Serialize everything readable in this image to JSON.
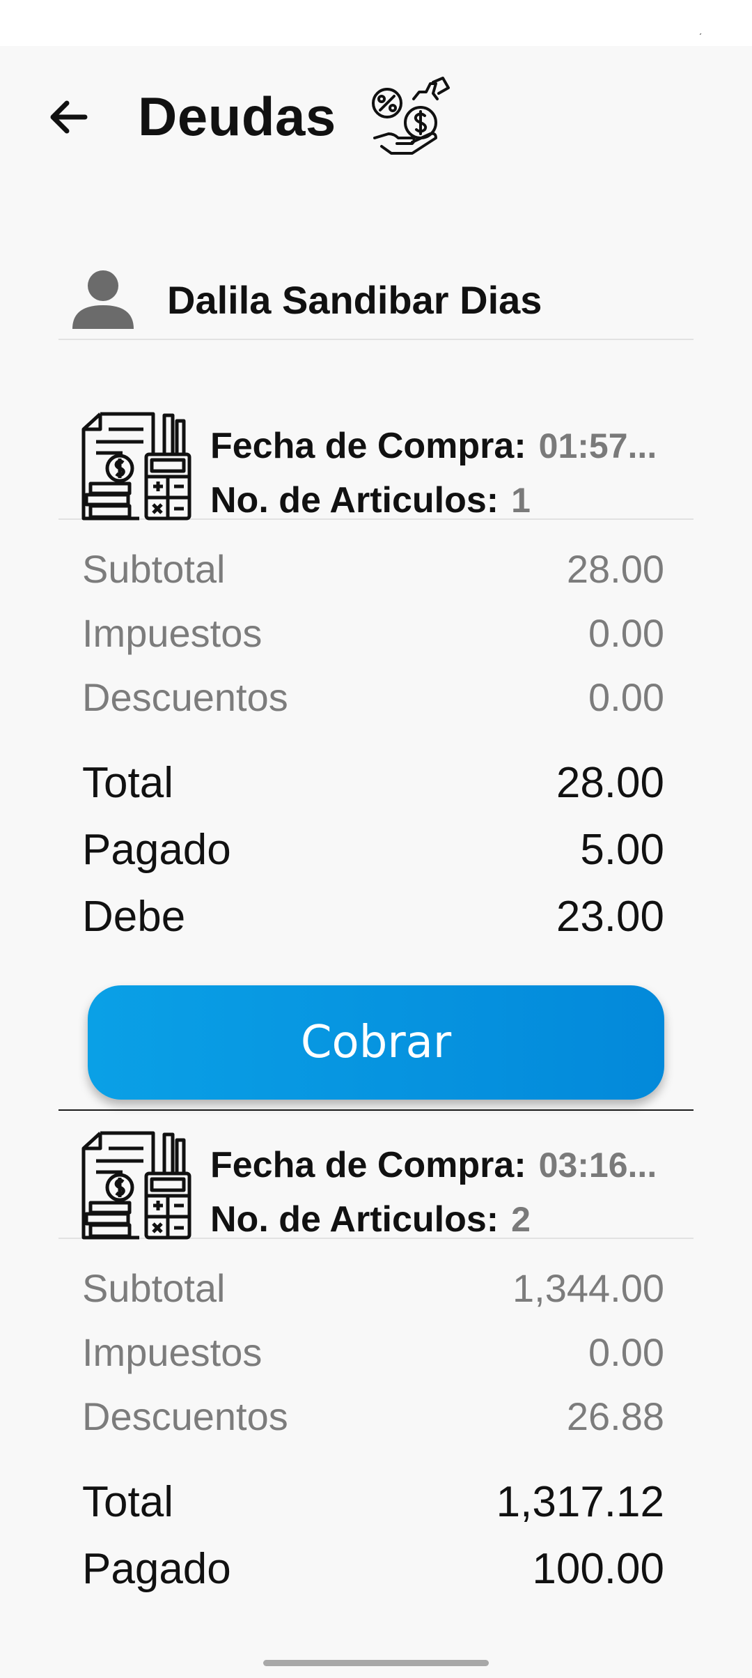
{
  "header": {
    "title": "Deudas",
    "back_icon": "arrow-left-icon",
    "title_icon": "money-hand-icon"
  },
  "customer": {
    "name": "Dalila Sandibar Dias",
    "icon": "person-icon"
  },
  "labels": {
    "purchase_date": "Fecha de Compra:",
    "item_count": "No. de Articulos:",
    "subtotal": "Subtotal",
    "taxes": "Impuestos",
    "discounts": "Descuentos",
    "total": "Total",
    "paid": "Pagado",
    "owes": "Debe",
    "charge_button": "Cobrar"
  },
  "debts": [
    {
      "date": "01:57...",
      "items": "1",
      "subtotal": "28.00",
      "taxes": "0.00",
      "discounts": "0.00",
      "total": "28.00",
      "paid": "5.00",
      "owes": "23.00"
    },
    {
      "date": "03:16...",
      "items": "2",
      "subtotal": "1,344.00",
      "taxes": "0.00",
      "discounts": "26.88",
      "total": "1,317.12",
      "paid": "100.00"
    }
  ],
  "colors": {
    "accent": "#0a96e0",
    "muted_text": "#7c7c7c",
    "background": "#f8f8f8"
  }
}
